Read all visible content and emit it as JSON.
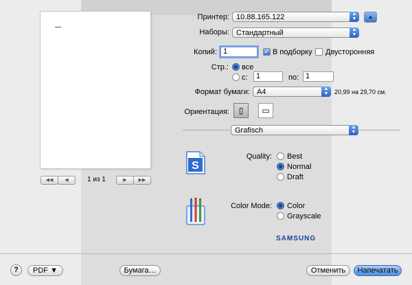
{
  "preview": {
    "page_label": "1 из 1",
    "nav": {
      "first": "◀◀",
      "prev": "◀",
      "next": "▶",
      "last": "▶▶"
    }
  },
  "printer": {
    "label": "Принтер:",
    "value": "10.88.165.122"
  },
  "presets": {
    "label": "Наборы:",
    "value": "Стандартный"
  },
  "copies": {
    "label": "Копий:",
    "value": "1",
    "collated_label": "В подборку",
    "collated": true,
    "duplex_label": "Двусторонняя",
    "duplex": false
  },
  "pages": {
    "label": "Стр.:",
    "all_label": "все",
    "from_label": "с:",
    "from_value": "1",
    "to_label": "по:",
    "to_value": "1"
  },
  "paper": {
    "label": "Формат бумаги:",
    "value": "A4",
    "size_text": "20,99 на 29,70 см."
  },
  "orientation": {
    "label": "Ориентация:"
  },
  "panel": {
    "value": "Grafisch"
  },
  "quality": {
    "label": "Quality:",
    "options": [
      "Best",
      "Normal",
      "Draft"
    ],
    "selected": "Normal"
  },
  "color_mode": {
    "label": "Color Mode:",
    "options": [
      "Color",
      "Grayscale"
    ],
    "selected": "Color"
  },
  "brand": "SAMSUNG",
  "footer": {
    "help": "?",
    "pdf": "PDF ▼",
    "paper_setup": "Бумага…",
    "cancel": "Отменить",
    "print": "Напечатать"
  },
  "colors": {
    "accent": "#3c76d6",
    "brand": "#1b3f9c"
  }
}
